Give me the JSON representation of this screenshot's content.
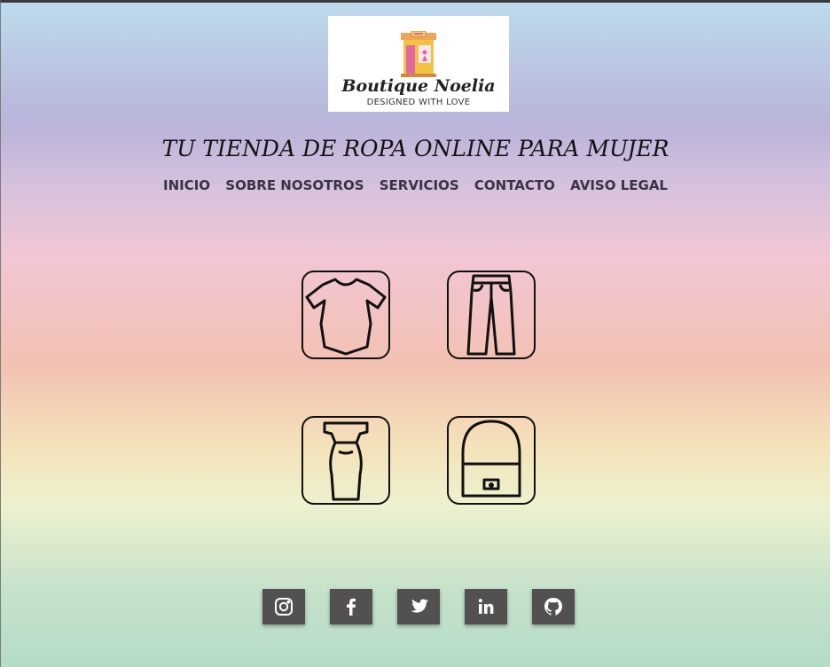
{
  "logo": {
    "brand": "Boutique Noelia",
    "tagline": "DESIGNED WITH LOVE"
  },
  "headline": "TU TIENDA DE ROPA ONLINE PARA MUJER",
  "nav": [
    {
      "label": "INICIO"
    },
    {
      "label": "SOBRE NOSOTROS"
    },
    {
      "label": "SERVICIOS"
    },
    {
      "label": "CONTACTO"
    },
    {
      "label": "AVISO LEGAL"
    }
  ],
  "categories": [
    {
      "icon": "tshirt-icon"
    },
    {
      "icon": "pants-icon"
    },
    {
      "icon": "dress-icon"
    },
    {
      "icon": "bag-icon"
    }
  ],
  "socials": [
    {
      "icon": "instagram-icon"
    },
    {
      "icon": "facebook-icon"
    },
    {
      "icon": "twitter-icon"
    },
    {
      "icon": "linkedin-icon"
    },
    {
      "icon": "github-icon"
    }
  ],
  "colors": {
    "nav_text": "#3a3245",
    "social_bg": "#525050"
  }
}
